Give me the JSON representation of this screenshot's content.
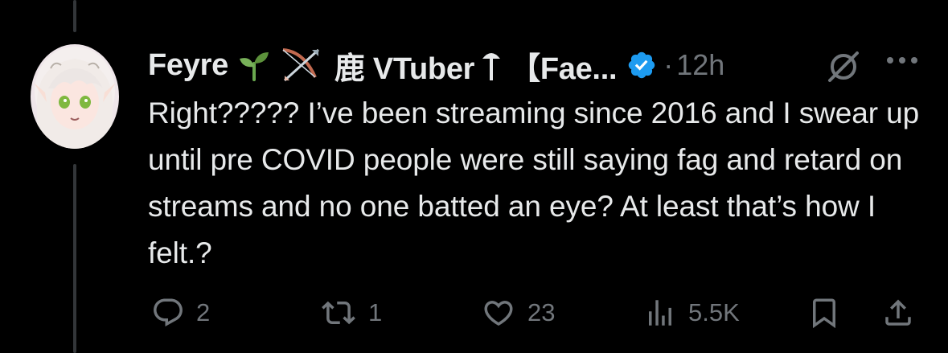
{
  "tweet": {
    "author_name": "Feyre",
    "author_name_rest": "鹿 VTuber",
    "author_name_bracket": "【Fae...",
    "separator": "·",
    "time": "12h",
    "text": "Right????? I’ve been streaming since 2016 and I swear up until pre COVID people were still saying fag and retard on streams and no one batted an eye? At least that’s how I felt.?"
  },
  "actions": {
    "replies": "2",
    "reposts": "1",
    "likes": "23",
    "views": "5.5K"
  },
  "colors": {
    "background": "#000000",
    "text_primary": "#e7e9ea",
    "text_secondary": "#71767b",
    "verified": "#1d9bf0",
    "thread_line": "#333639"
  },
  "icons": {
    "emoji_1": "seedling-emoji",
    "emoji_2": "bow-and-arrow-emoji",
    "emoji_3": "mushroom-emoji",
    "verified": "verified-badge-icon",
    "grok": "grok-icon",
    "more": "more-icon",
    "reply": "reply-icon",
    "repost": "repost-icon",
    "like": "heart-icon",
    "views": "views-icon",
    "bookmark": "bookmark-icon",
    "share": "share-icon"
  }
}
